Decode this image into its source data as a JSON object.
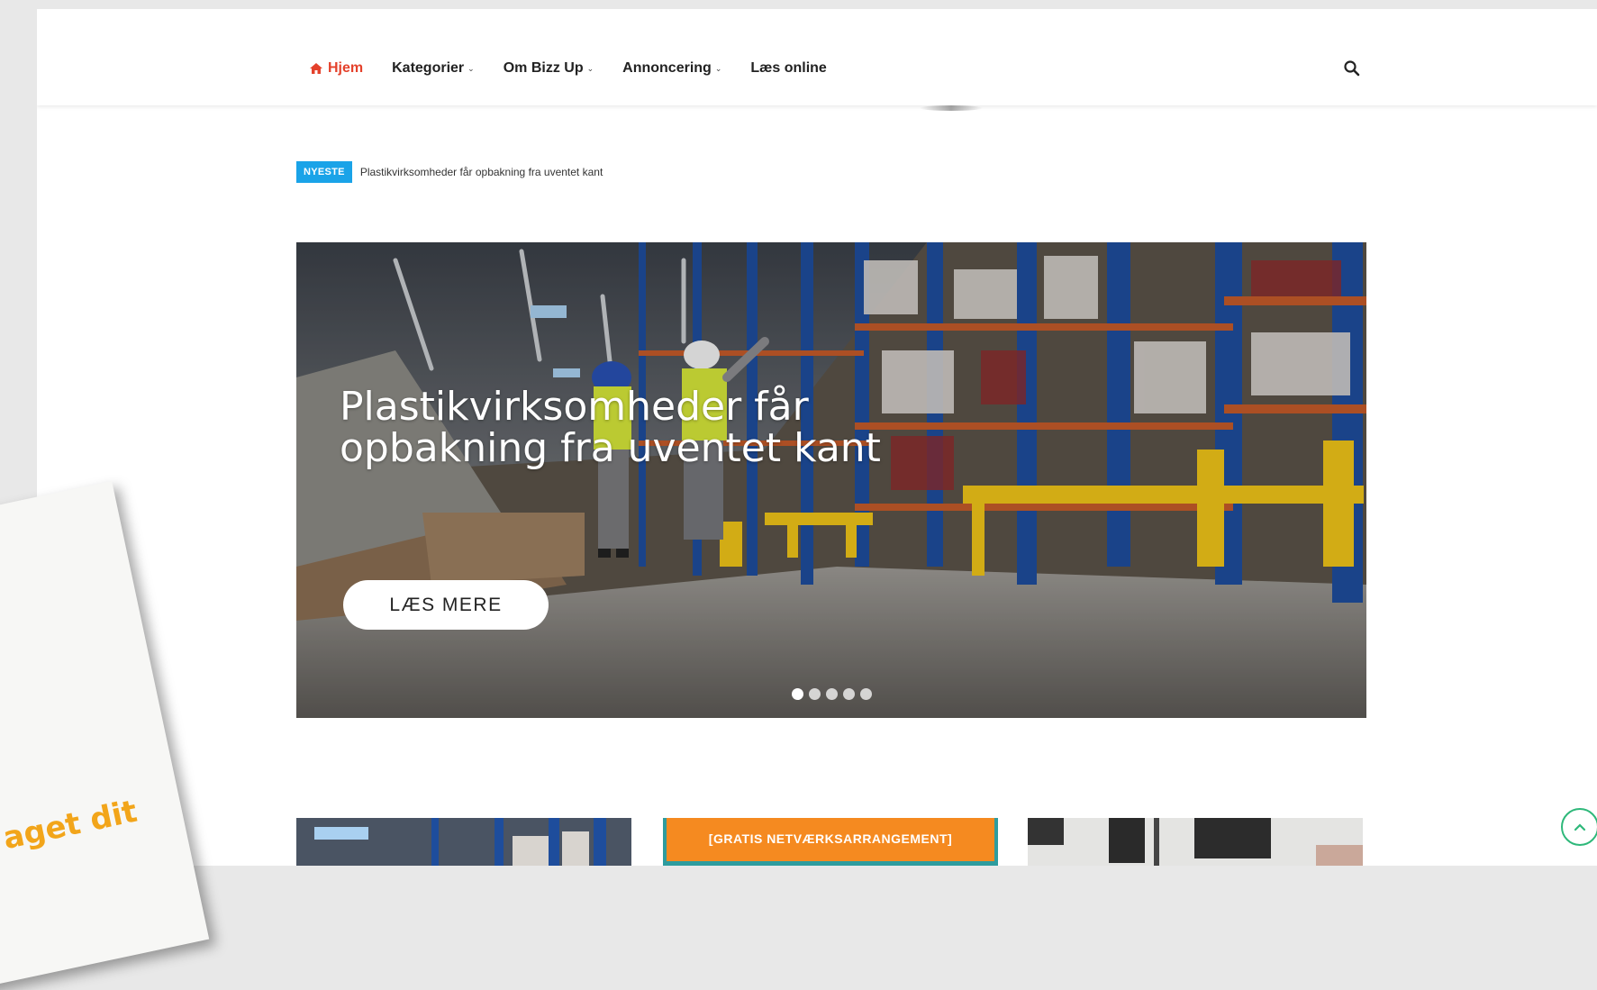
{
  "nav": {
    "items": [
      {
        "label": "Hjem",
        "active": true,
        "icon": "home-icon"
      },
      {
        "label": "Kategorier",
        "dropdown": true
      },
      {
        "label": "Om Bizz Up",
        "dropdown": true
      },
      {
        "label": "Annoncering",
        "dropdown": true
      },
      {
        "label": "Læs online",
        "dropdown": false
      }
    ],
    "search_icon": "search-icon"
  },
  "ticker": {
    "badge": "NYESTE",
    "text": "Plastikvirksomheder får opbakning fra uventet kant"
  },
  "hero": {
    "title": "Plastikvirksomheder får opbakning fra uventet kant",
    "button_label": "LÆS MERE",
    "slide_count": 5,
    "active_slide": 1
  },
  "cards": {
    "badge": "[GRATIS NETVÆRKSARRANGEMENT]"
  },
  "overlay": {
    "paper_text": "aget dit"
  },
  "colors": {
    "accent": "#e4412b",
    "ticker_badge": "#1aa3e8",
    "card_badge": "#f58a20",
    "scroll_top": "#2eb87a",
    "paper_text": "#f2a51a"
  }
}
